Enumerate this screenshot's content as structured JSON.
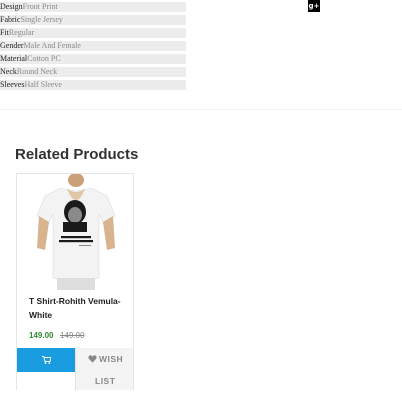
{
  "specs": [
    {
      "key": "Design",
      "value": "Front Print"
    },
    {
      "key": "Fabric",
      "value": "Single Jersey"
    },
    {
      "key": "Fit",
      "value": "Regular"
    },
    {
      "key": "Gender",
      "value": "Male And Female"
    },
    {
      "key": "Material",
      "value": "Cotton PC"
    },
    {
      "key": "Neck",
      "value": "Round Neck"
    },
    {
      "key": "Sleeves",
      "value": "Half Sleeve"
    }
  ],
  "social": {
    "gplus_label": "g+"
  },
  "related": {
    "title": "Related Products",
    "products": [
      {
        "name": "T Shirt-Rohith Vemula-White",
        "image_caption": "I AM HAPPY DEAD THAN BEING ALIVE",
        "price": "149.00",
        "old_price": "149.00",
        "wishlist_label_1": "WISH",
        "wishlist_label_2": "LIST"
      }
    ]
  },
  "colors": {
    "accent": "#1a9de0",
    "price": "#2e8b32"
  }
}
